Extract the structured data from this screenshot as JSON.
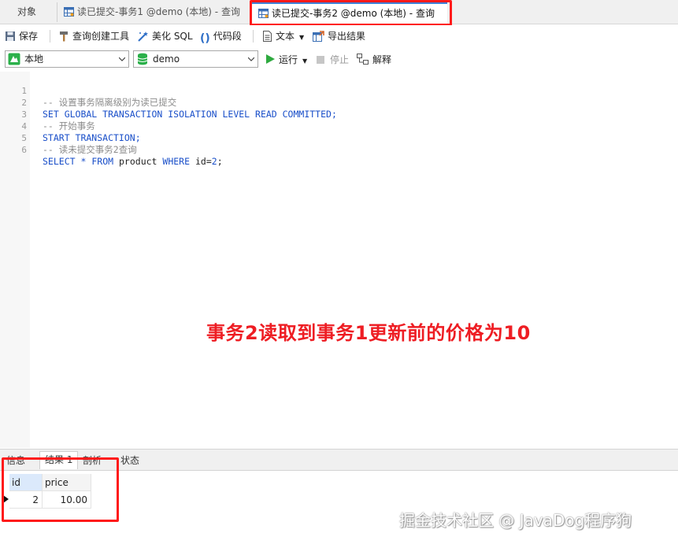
{
  "tabs": [
    {
      "label": "对象"
    },
    {
      "label": "读已提交-事务1 @demo (本地) - 查询"
    },
    {
      "label": "读已提交-事务2 @demo (本地) - 查询"
    }
  ],
  "toolbar": {
    "save": "保存",
    "query_builder": "查询创建工具",
    "beautify": "美化 SQL",
    "snippet": "代码段",
    "text": "文本",
    "export": "导出结果"
  },
  "selectors": {
    "connection": "本地",
    "database": "demo",
    "run": "运行",
    "stop": "停止",
    "explain": "解释"
  },
  "editor": {
    "lines": [
      {
        "n": "1",
        "text": "-- 设置事务隔离级别为读已提交"
      },
      {
        "n": "2",
        "text": "SET GLOBAL TRANSACTION ISOLATION LEVEL READ COMMITTED;"
      },
      {
        "n": "3",
        "text": "-- 开始事务"
      },
      {
        "n": "4",
        "text": "START TRANSACTION;"
      },
      {
        "n": "5",
        "text": "-- 读未提交事务2查询"
      },
      {
        "n": "6",
        "text": "SELECT * FROM product WHERE id=2;"
      }
    ]
  },
  "annotation": "事务2读取到事务1更新前的价格为10",
  "result_tabs": [
    "信息",
    "结果 1",
    "剖析",
    "状态"
  ],
  "result": {
    "columns": [
      "id",
      "price"
    ],
    "rows": [
      [
        "2",
        "10.00"
      ]
    ]
  },
  "watermark": "掘金技术社区 @ JavaDog程序狗",
  "colors": {
    "highlight": "#ff1a1a",
    "annotation": "#ee1d23",
    "keyword": "#1a4fc9",
    "comment": "#8c8c8c"
  }
}
